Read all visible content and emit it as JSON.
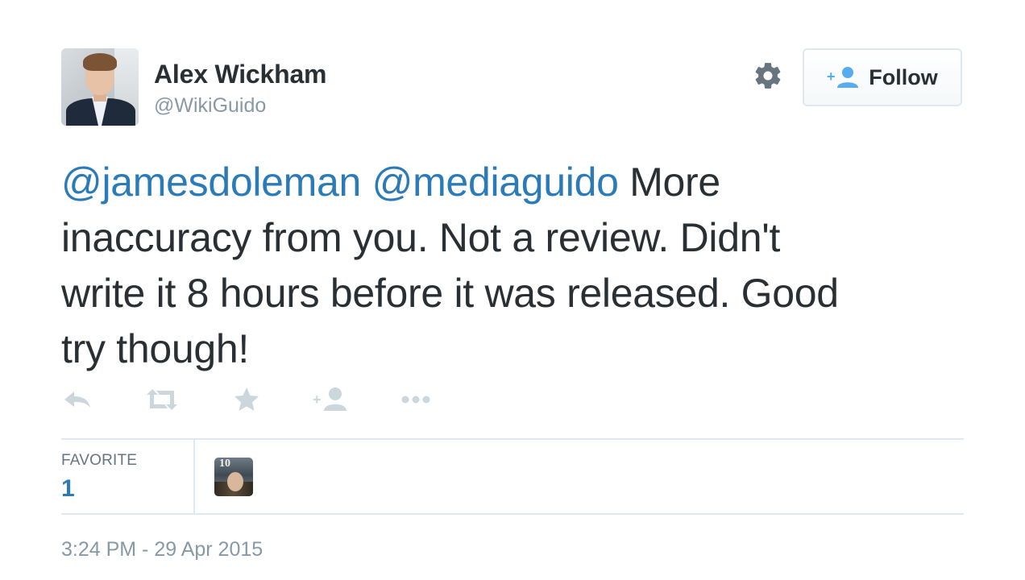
{
  "author": {
    "name": "Alex Wickham",
    "handle": "@WikiGuido"
  },
  "header": {
    "follow_label": "Follow"
  },
  "tweet": {
    "mention1": "@jamesdoleman",
    "mention2": "@mediaguido",
    "line1_text": " More",
    "line2": "inaccuracy from you. Not a review. Didn't",
    "line3": "write it 8 hours before it was released. Good",
    "line4": "try though!"
  },
  "actions": [
    "reply-icon",
    "retweet-icon",
    "favorite-icon",
    "follow-icon",
    "more-icon"
  ],
  "stats": {
    "favorite_label": "FAVORITE",
    "favorite_count": "1"
  },
  "timestamp": "3:24 PM - 29 Apr 2015",
  "colors": {
    "link": "#2b7bb9",
    "muted": "#8899a6",
    "text": "#292f33",
    "icon": "#ccd6dd",
    "divider": "#e1e8ed"
  }
}
